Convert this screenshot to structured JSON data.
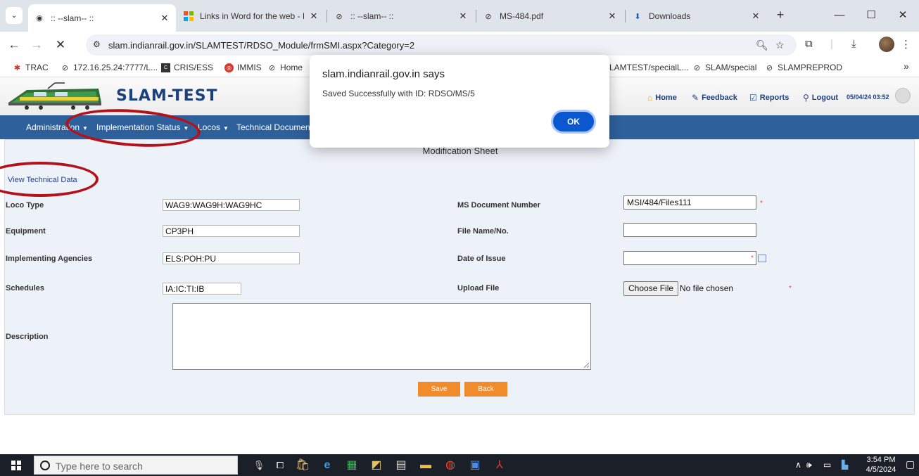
{
  "browser": {
    "tabs": [
      {
        "title": ":: --slam-- ::",
        "icon": "slam-favicon",
        "active": true
      },
      {
        "title": "Links in Word for the web - I",
        "icon": "windows-favicon",
        "active": false
      },
      {
        "title": ":: --slam-- ::",
        "icon": "globe-icon",
        "active": false
      },
      {
        "title": "MS-484.pdf",
        "icon": "globe-icon",
        "active": false
      },
      {
        "title": "Downloads",
        "icon": "download-icon",
        "active": false
      }
    ],
    "url": "slam.indianrail.gov.in/SLAMTEST/RDSO_Module/frmSMI.aspx?Category=2",
    "bookmarks": [
      {
        "label": "TRAC",
        "icon": "trac-icon"
      },
      {
        "label": "172.16.25.24:7777/L...",
        "icon": "globe-icon"
      },
      {
        "label": "CRIS/ESS",
        "icon": "cris-icon"
      },
      {
        "label": "IMMIS",
        "icon": "immis-icon"
      },
      {
        "label": "Home",
        "icon": "globe-icon"
      },
      {
        "label": "LAMTEST/specialL...",
        "icon": "none"
      },
      {
        "label": "SLAM/special",
        "icon": "globe-icon"
      },
      {
        "label": "SLAMPREPROD",
        "icon": "globe-icon"
      }
    ],
    "bookmarks_overflow": "»"
  },
  "header": {
    "logo_text": "SLAM-TEST",
    "links": [
      {
        "label": "Home",
        "icon": "home-icon"
      },
      {
        "label": "Feedback",
        "icon": "feedback-icon"
      },
      {
        "label": "Reports",
        "icon": "reports-icon"
      },
      {
        "label": "Logout",
        "icon": "logout-icon"
      }
    ],
    "datetime": "05/04/24 03:52"
  },
  "menu": [
    {
      "label": "Administration"
    },
    {
      "label": "Implementation Status"
    },
    {
      "label": "Locos"
    },
    {
      "label": "Technical Documen"
    }
  ],
  "form": {
    "title": "Modification Sheet",
    "view_link": "View Technical Data",
    "loco_type_label": "Loco Type",
    "loco_type_value": "WAG9:WAG9H:WAG9HC",
    "equipment_label": "Equipment",
    "equipment_value": "CP3PH",
    "agencies_label": "Implementing Agencies",
    "agencies_value": "ELS:POH:PU",
    "schedules_label": "Schedules",
    "schedules_value": "IA:IC:TI:IB",
    "description_label": "Description",
    "ms_doc_label": "MS Document Number",
    "ms_doc_value": "MSI/484/Files111",
    "file_name_label": "File Name/No.",
    "file_name_value": "",
    "date_issue_label": "Date of Issue",
    "date_issue_value": "",
    "upload_label": "Upload File",
    "choose_file_label": "Choose File",
    "no_file_text": "No file chosen",
    "required_mark": "*",
    "save_label": "Save",
    "back_label": "Back"
  },
  "dialog": {
    "title": "slam.indianrail.gov.in says",
    "message": "Saved Successfully with ID: RDSO/MS/5",
    "ok_label": "OK"
  },
  "taskbar": {
    "search_placeholder": "Type here to search",
    "time": "3:54 PM",
    "date": "4/5/2024"
  },
  "colors": {
    "menu_bar": "#2e609c",
    "accent_orange": "#f08c2c",
    "annotation_red": "#b3121a",
    "dialog_ok": "#0b57d0"
  }
}
